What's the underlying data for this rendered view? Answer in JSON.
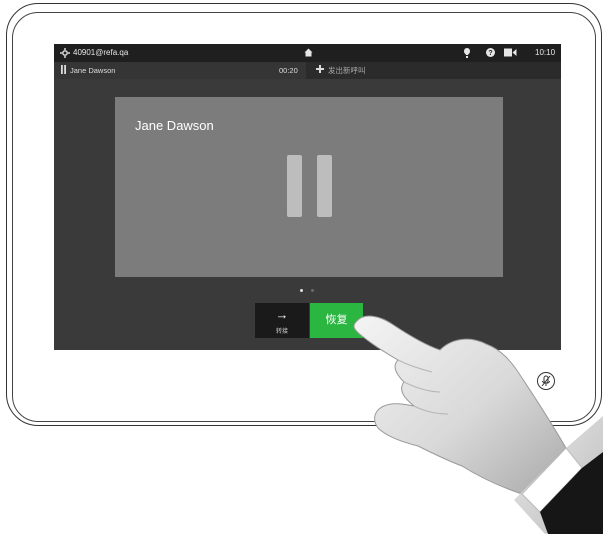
{
  "status_bar": {
    "account": "40901@refa.qa",
    "time": "10:10"
  },
  "call_bar": {
    "paused_caller": "Jane Dawson",
    "duration": "00:20",
    "new_call_label": "发出新呼叫"
  },
  "video": {
    "caller_name": "Jane Dawson"
  },
  "controls": {
    "transfer_label": "转接",
    "resume_label": "恢复"
  },
  "colors": {
    "accent_green": "#2bb541",
    "screen_bg": "#3a3a3a"
  }
}
